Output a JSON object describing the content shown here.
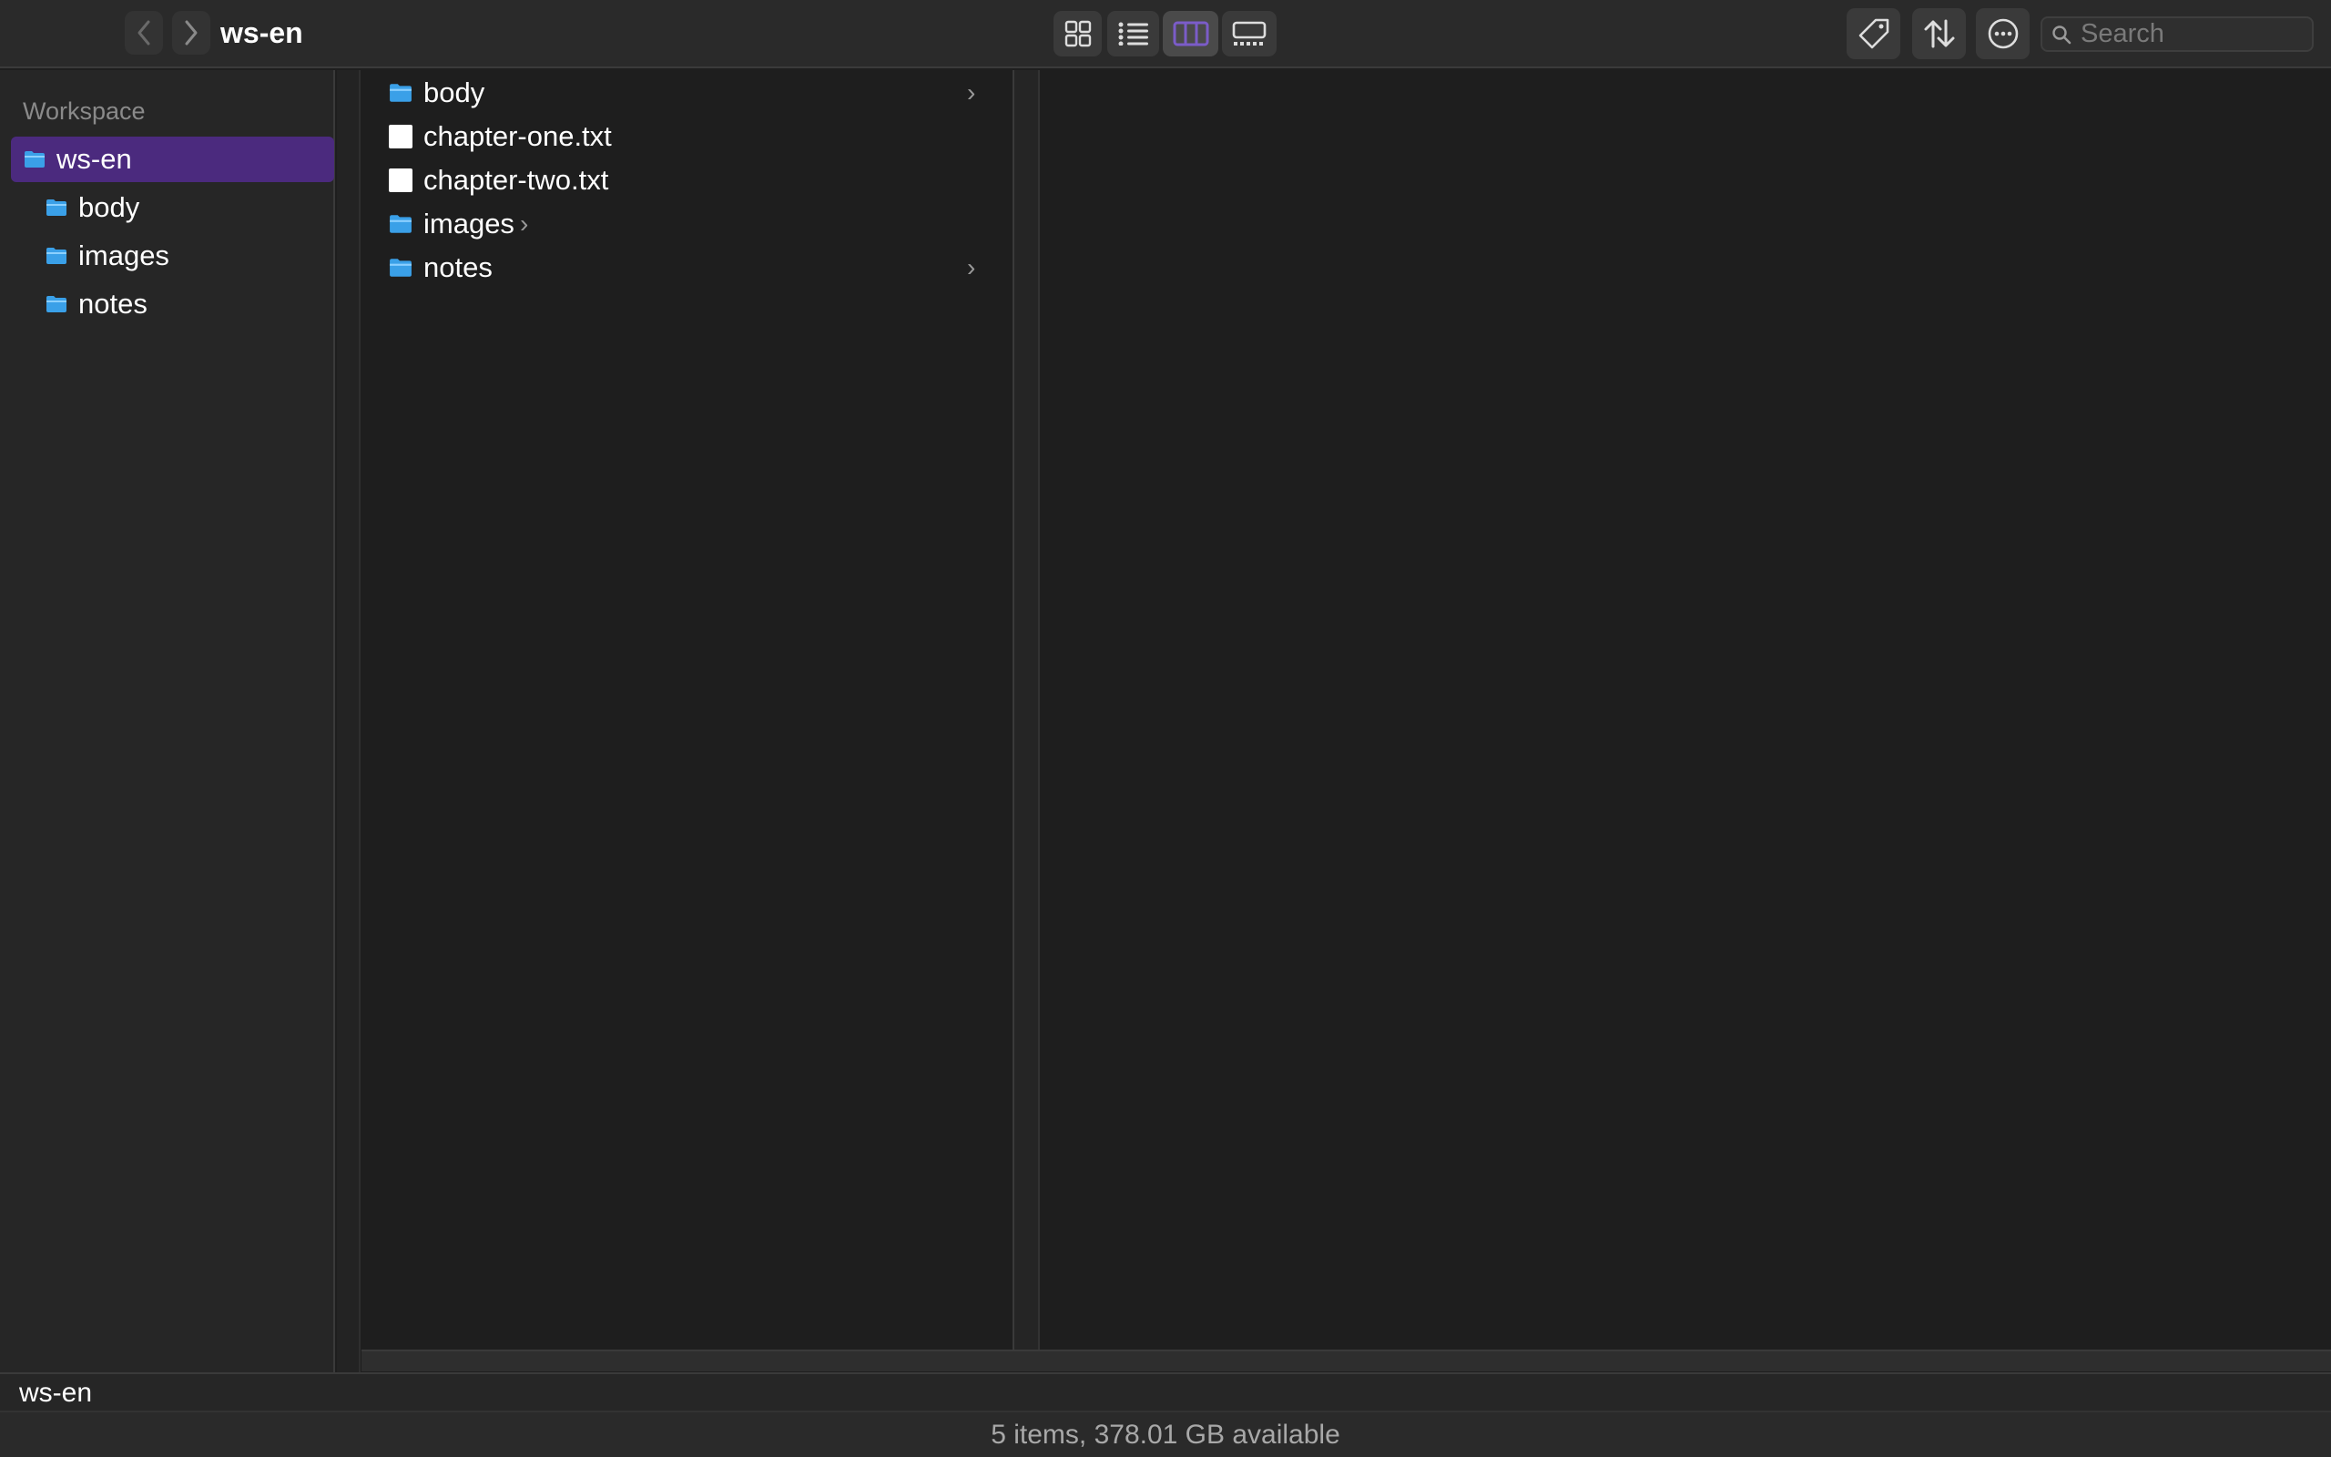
{
  "window": {
    "title": "ws-en"
  },
  "toolbar": {
    "back_icon": "chevron-left-icon",
    "forward_icon": "chevron-right-icon",
    "view_modes": [
      "icon-view",
      "list-view",
      "column-view",
      "gallery-view"
    ],
    "active_view": "column-view",
    "tag_icon": "tag-icon",
    "sort_icon": "sort-arrows-icon",
    "more_icon": "ellipsis-circle-icon",
    "search_placeholder": "Search"
  },
  "sidebar": {
    "heading": "Workspace",
    "items": [
      {
        "label": "ws-en",
        "selected": true
      },
      {
        "label": "body"
      },
      {
        "label": "images"
      },
      {
        "label": "notes"
      }
    ]
  },
  "column": {
    "items": [
      {
        "label": "body",
        "type": "folder"
      },
      {
        "label": "chapter-one.txt",
        "type": "file"
      },
      {
        "label": "chapter-two.txt",
        "type": "file"
      },
      {
        "label": "images",
        "type": "folder"
      },
      {
        "label": "notes",
        "type": "folder"
      }
    ]
  },
  "pathbar": {
    "path": "ws-en"
  },
  "status": {
    "text": "5 items, 378.01 GB available"
  },
  "colors": {
    "accent_selection": "#4b2a7e",
    "active_view_icon": "#7b5cc8",
    "folder": "#3aa0e8"
  }
}
